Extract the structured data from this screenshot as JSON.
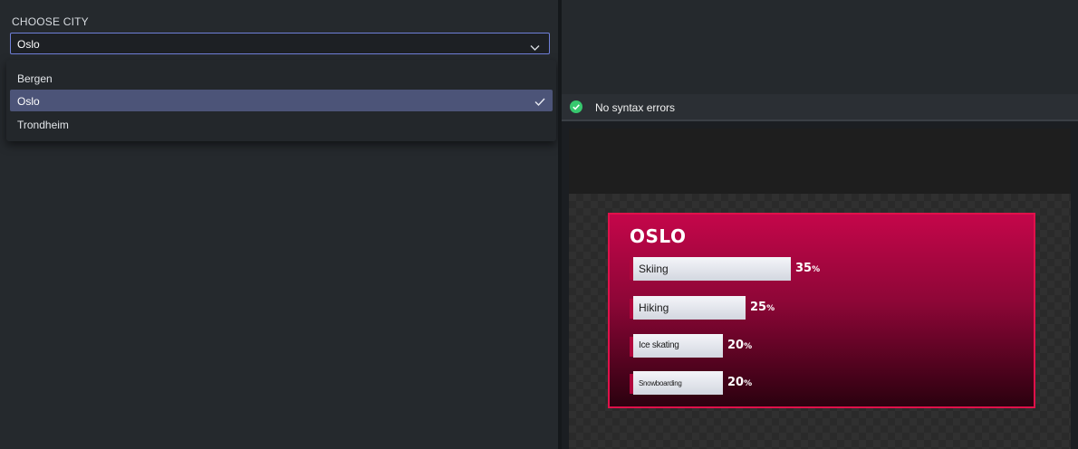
{
  "settings": {
    "section_label": "CHOOSE CITY",
    "select_value": "Oslo",
    "options": [
      {
        "label": "Bergen",
        "selected": false
      },
      {
        "label": "Oslo",
        "selected": true
      },
      {
        "label": "Trondheim",
        "selected": false
      }
    ]
  },
  "status": {
    "text": "No syntax errors",
    "icon": "check-circle-icon",
    "color": "#37c86e"
  },
  "graphic": {
    "title": "OSLO",
    "accent_color": "#e0114a",
    "bars": [
      {
        "label": "Skiing",
        "value": "35",
        "unit": "%",
        "percent": 35
      },
      {
        "label": "Hiking",
        "value": "25",
        "unit": "%",
        "percent": 25
      },
      {
        "label": "Ice skating",
        "value": "20",
        "unit": "%",
        "percent": 20
      },
      {
        "label": "Snowboarding",
        "value": "20",
        "unit": "%",
        "percent": 20
      }
    ]
  }
}
